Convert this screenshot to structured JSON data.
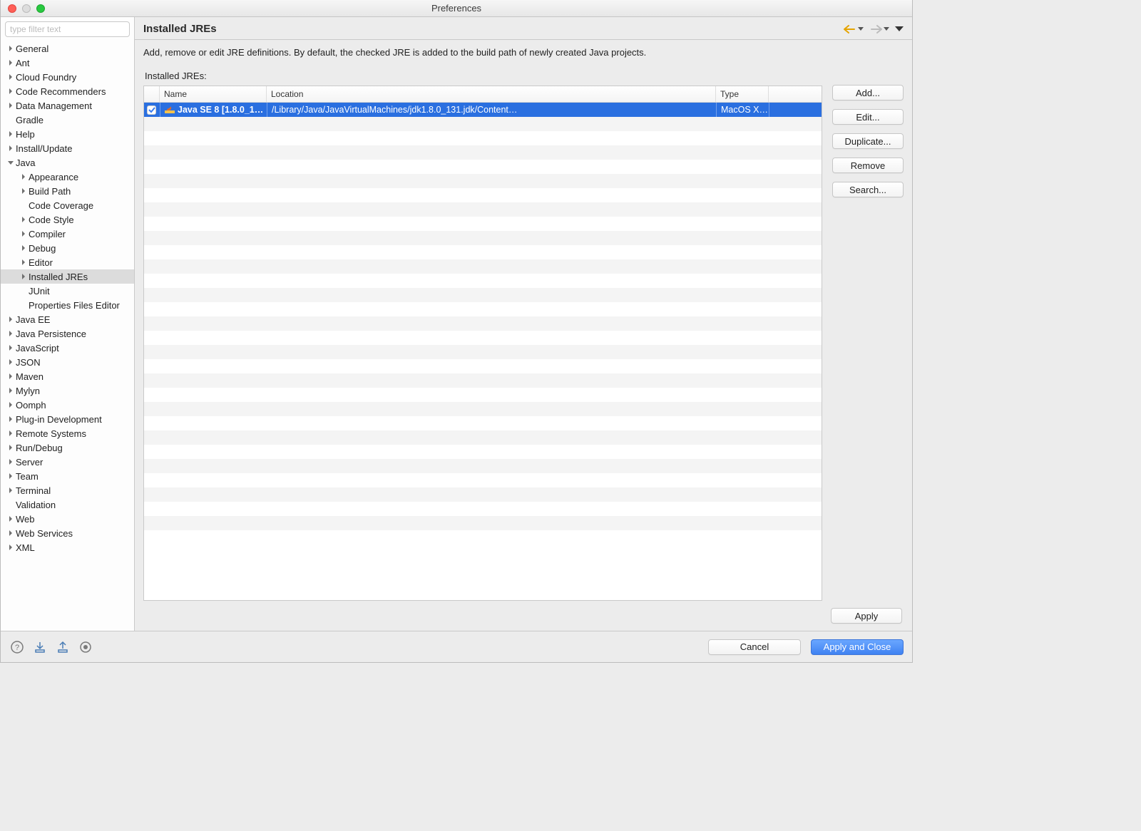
{
  "window": {
    "title": "Preferences"
  },
  "sidebar": {
    "filter_placeholder": "type filter text",
    "items": [
      {
        "label": "General",
        "depth": 0,
        "arrow": "right"
      },
      {
        "label": "Ant",
        "depth": 0,
        "arrow": "right"
      },
      {
        "label": "Cloud Foundry",
        "depth": 0,
        "arrow": "right"
      },
      {
        "label": "Code Recommenders",
        "depth": 0,
        "arrow": "right"
      },
      {
        "label": "Data Management",
        "depth": 0,
        "arrow": "right"
      },
      {
        "label": "Gradle",
        "depth": 0,
        "arrow": "none"
      },
      {
        "label": "Help",
        "depth": 0,
        "arrow": "right"
      },
      {
        "label": "Install/Update",
        "depth": 0,
        "arrow": "right"
      },
      {
        "label": "Java",
        "depth": 0,
        "arrow": "down"
      },
      {
        "label": "Appearance",
        "depth": 1,
        "arrow": "right"
      },
      {
        "label": "Build Path",
        "depth": 1,
        "arrow": "right"
      },
      {
        "label": "Code Coverage",
        "depth": 1,
        "arrow": "none"
      },
      {
        "label": "Code Style",
        "depth": 1,
        "arrow": "right"
      },
      {
        "label": "Compiler",
        "depth": 1,
        "arrow": "right"
      },
      {
        "label": "Debug",
        "depth": 1,
        "arrow": "right"
      },
      {
        "label": "Editor",
        "depth": 1,
        "arrow": "right"
      },
      {
        "label": "Installed JREs",
        "depth": 1,
        "arrow": "right",
        "selected": true
      },
      {
        "label": "JUnit",
        "depth": 1,
        "arrow": "none"
      },
      {
        "label": "Properties Files Editor",
        "depth": 1,
        "arrow": "none"
      },
      {
        "label": "Java EE",
        "depth": 0,
        "arrow": "right"
      },
      {
        "label": "Java Persistence",
        "depth": 0,
        "arrow": "right"
      },
      {
        "label": "JavaScript",
        "depth": 0,
        "arrow": "right"
      },
      {
        "label": "JSON",
        "depth": 0,
        "arrow": "right"
      },
      {
        "label": "Maven",
        "depth": 0,
        "arrow": "right"
      },
      {
        "label": "Mylyn",
        "depth": 0,
        "arrow": "right"
      },
      {
        "label": "Oomph",
        "depth": 0,
        "arrow": "right"
      },
      {
        "label": "Plug-in Development",
        "depth": 0,
        "arrow": "right"
      },
      {
        "label": "Remote Systems",
        "depth": 0,
        "arrow": "right"
      },
      {
        "label": "Run/Debug",
        "depth": 0,
        "arrow": "right"
      },
      {
        "label": "Server",
        "depth": 0,
        "arrow": "right"
      },
      {
        "label": "Team",
        "depth": 0,
        "arrow": "right"
      },
      {
        "label": "Terminal",
        "depth": 0,
        "arrow": "right"
      },
      {
        "label": "Validation",
        "depth": 0,
        "arrow": "none"
      },
      {
        "label": "Web",
        "depth": 0,
        "arrow": "right"
      },
      {
        "label": "Web Services",
        "depth": 0,
        "arrow": "right"
      },
      {
        "label": "XML",
        "depth": 0,
        "arrow": "right"
      }
    ]
  },
  "main": {
    "title": "Installed JREs",
    "description": "Add, remove or edit JRE definitions. By default, the checked JRE is added to the build path of newly created Java projects.",
    "table_label": "Installed JREs:",
    "columns": {
      "name": "Name",
      "location": "Location",
      "type": "Type"
    },
    "rows": [
      {
        "checked": true,
        "name": "Java SE 8 [1.8.0_1…",
        "location": "/Library/Java/JavaVirtualMachines/jdk1.8.0_131.jdk/Content…",
        "type": "MacOS X…"
      }
    ],
    "buttons": {
      "add": "Add...",
      "edit": "Edit...",
      "duplicate": "Duplicate...",
      "remove": "Remove",
      "search": "Search..."
    },
    "apply": "Apply"
  },
  "footer": {
    "cancel": "Cancel",
    "apply_close": "Apply and Close"
  }
}
